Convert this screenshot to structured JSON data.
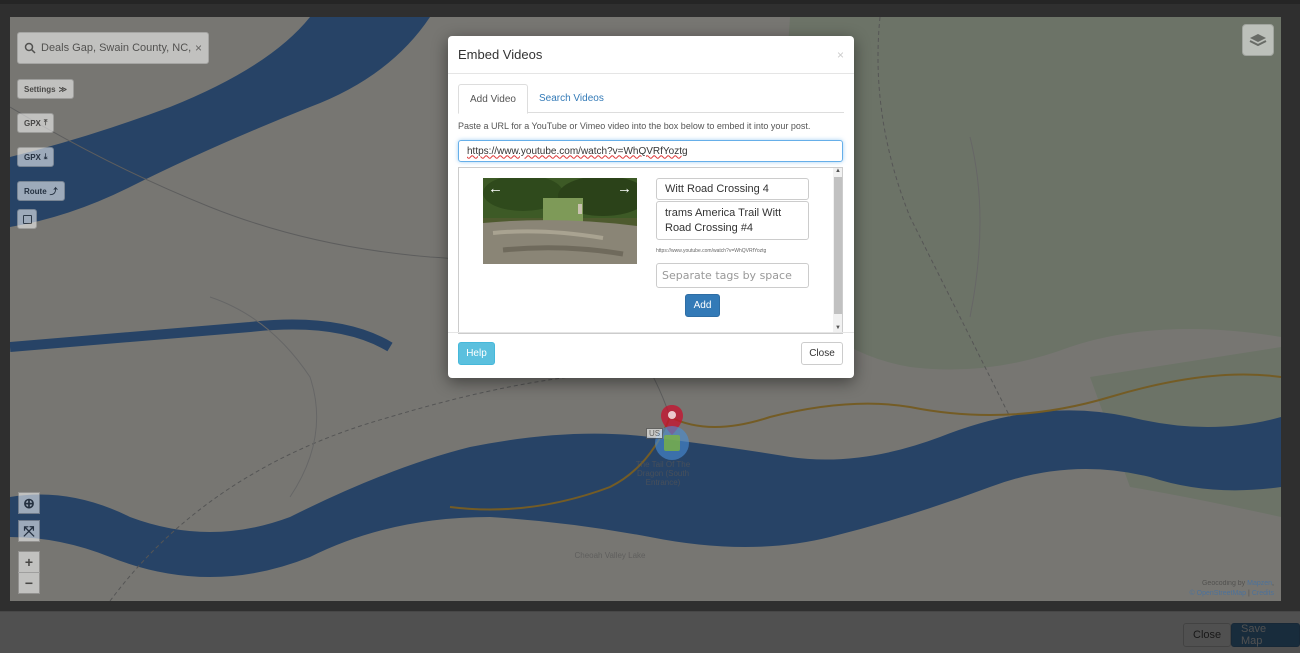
{
  "map": {
    "search_query": "Deals Gap, Swain County, NC, US/",
    "clear_glyph": "×",
    "side_buttons": [
      {
        "label": "Settings",
        "glyph": "≫"
      },
      {
        "label": "GPX",
        "glyph": "⤒"
      },
      {
        "label": "GPX",
        "glyph": "⤓"
      },
      {
        "label": "Route",
        "glyph": "⤴"
      }
    ],
    "labels": {
      "road_shield": "US",
      "poi": "The Tail Of The Dragon (South Entrance)",
      "lake": "Cheoah Valley Lake"
    },
    "controls": {
      "locate": "⊕",
      "fullscreen": "⤧",
      "zoom_in": "+",
      "zoom_out": "−"
    },
    "attribution": {
      "geocoding_prefix": "Geocoding by",
      "geocoding_link": "Mapzen",
      "osm_link": "© OpenStreetMap",
      "separator": "|",
      "credits_link": "Credits"
    }
  },
  "footer": {
    "close_label": "Close",
    "save_label": "Save Map"
  },
  "modal": {
    "title": "Embed Videos",
    "close_glyph": "×",
    "tabs": [
      {
        "label": "Add Video",
        "active": true
      },
      {
        "label": "Search Videos",
        "active": false
      }
    ],
    "instructions": "Paste a URL for a YouTube or Vimeo video into the box below to embed it into your post.",
    "url_value": "https://www.youtube.com/watch?v=WhQVRfYoztg",
    "video": {
      "title": "Witt Road Crossing 4",
      "description": "trams America Trail Witt Road Crossing #4",
      "link": "https://www.youtube.com/watch?v=WhQVRfYoztg",
      "tags_placeholder": "Separate tags by space",
      "add_label": "Add",
      "prev_glyph": "←",
      "next_glyph": "→"
    },
    "help_label": "Help",
    "close_label": "Close"
  },
  "colors": {
    "primary": "#337ab7",
    "info": "#5bc0de",
    "river": "#2e6db4",
    "marker": "#c8102e"
  }
}
